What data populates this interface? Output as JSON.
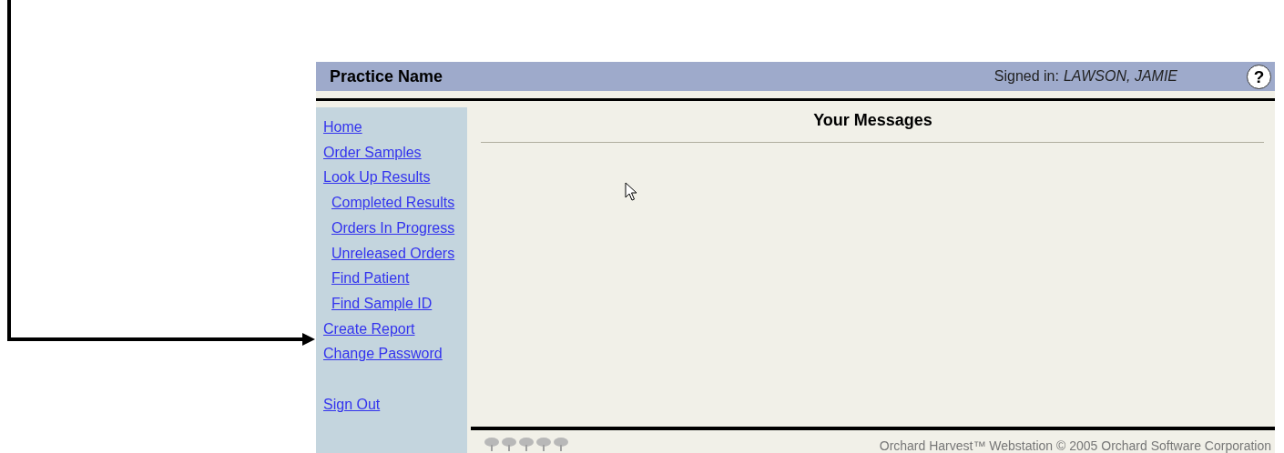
{
  "header": {
    "practice_name": "Practice Name",
    "signed_in_label": "Signed in:",
    "user_name": "LAWSON, JAMIE",
    "help": "?"
  },
  "sidebar": {
    "items": [
      {
        "label": "Home"
      },
      {
        "label": "Order Samples"
      },
      {
        "label": "Look Up Results",
        "children": [
          {
            "label": "Completed Results"
          },
          {
            "label": "Orders In Progress"
          },
          {
            "label": "Unreleased Orders"
          },
          {
            "label": "Find Patient"
          },
          {
            "label": "Find Sample ID"
          }
        ]
      },
      {
        "label": "Create Report"
      },
      {
        "label": "Change Password"
      }
    ],
    "sign_out": "Sign Out"
  },
  "content": {
    "title": "Your Messages"
  },
  "footer": {
    "copyright": "Orchard Harvest™ Webstation © 2005 Orchard Software Corporation"
  }
}
